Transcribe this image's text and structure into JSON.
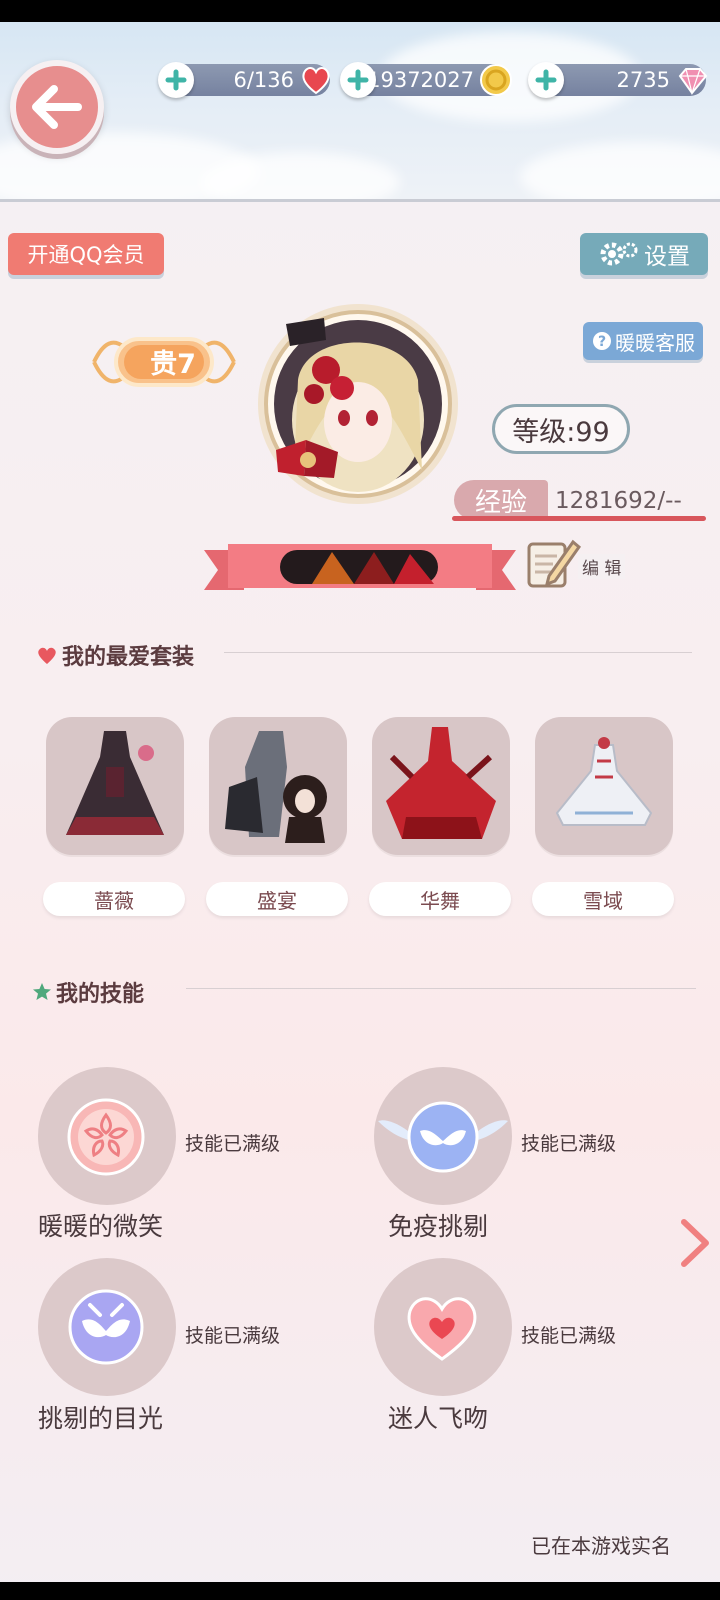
{
  "header": {
    "resources": {
      "stamina": "6/136",
      "gold": "19372027",
      "diamonds": "2735"
    }
  },
  "buttons": {
    "qq_member": "开通QQ会员",
    "settings": "设置",
    "customer_service": "暖暖客服",
    "edit": "编 辑"
  },
  "profile": {
    "vip": "贵7",
    "level": "等级:99",
    "exp_label": "经验",
    "exp_value": "1281692/--"
  },
  "favorites": {
    "title": "我的最爱套装",
    "outfits": [
      {
        "name": "蔷薇",
        "icon": "outfit-rose-icon"
      },
      {
        "name": "盛宴",
        "icon": "outfit-feast-icon"
      },
      {
        "name": "华舞",
        "icon": "outfit-dance-icon"
      },
      {
        "name": "雪域",
        "icon": "outfit-snow-icon"
      }
    ]
  },
  "skills": {
    "title": "我的技能",
    "items": [
      {
        "name": "暖暖的微笑",
        "status": "技能已满级",
        "icon": "sakura-icon"
      },
      {
        "name": "免疫挑剔",
        "status": "技能已满级",
        "icon": "winged-mask-icon"
      },
      {
        "name": "挑剔的目光",
        "status": "技能已满级",
        "icon": "mask-icon"
      },
      {
        "name": "迷人飞吻",
        "status": "技能已满级",
        "icon": "heart-icon"
      }
    ]
  },
  "footer": {
    "realname": "已在本游戏实名"
  },
  "colors": {
    "accent_red": "#f07b72",
    "settings_blue": "#76aab9",
    "exp_red": "#d8565c"
  }
}
